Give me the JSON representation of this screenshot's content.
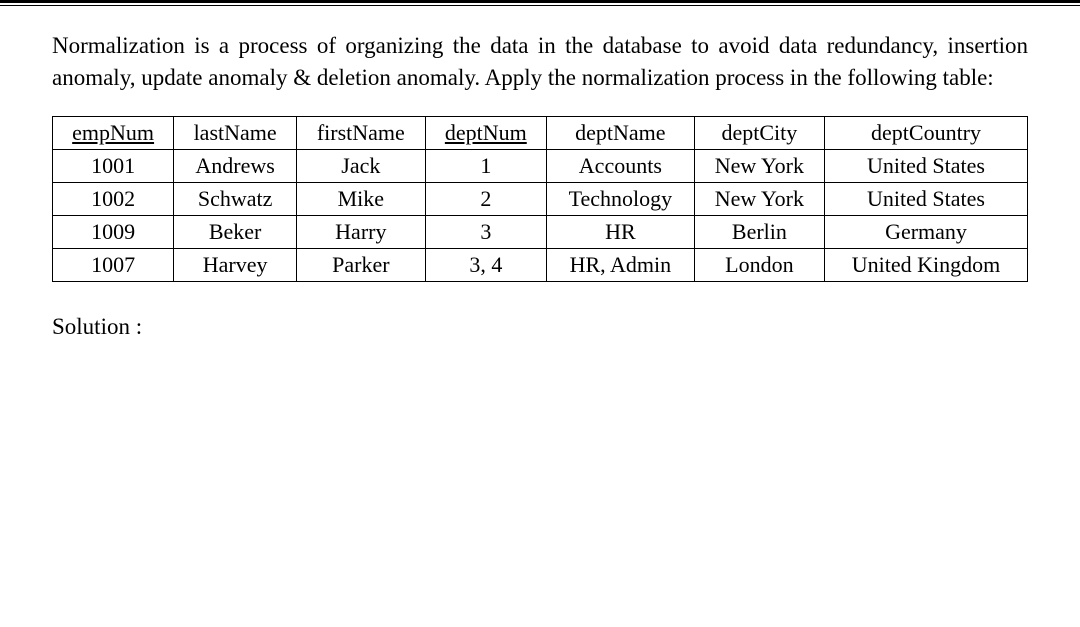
{
  "intro": "Normalization is a process of organizing the data in the database to avoid data redundancy, insertion anomaly, update anomaly & deletion anomaly. Apply the normalization process in the following table:",
  "table": {
    "headers": {
      "empNum": "empNum",
      "lastName": "lastName",
      "firstName": "firstName",
      "deptNum": "deptNum",
      "deptName": "deptName",
      "deptCity": "deptCity",
      "deptCountry": "deptCountry"
    },
    "rows": [
      {
        "empNum": "1001",
        "lastName": "Andrews",
        "firstName": "Jack",
        "deptNum": "1",
        "deptName": "Accounts",
        "deptCity": "New York",
        "deptCountry": "United States"
      },
      {
        "empNum": "1002",
        "lastName": "Schwatz",
        "firstName": "Mike",
        "deptNum": "2",
        "deptName": "Technology",
        "deptCity": "New York",
        "deptCountry": "United States"
      },
      {
        "empNum": "1009",
        "lastName": "Beker",
        "firstName": "Harry",
        "deptNum": "3",
        "deptName": "HR",
        "deptCity": "Berlin",
        "deptCountry": "Germany"
      },
      {
        "empNum": "1007",
        "lastName": "Harvey",
        "firstName": "Parker",
        "deptNum": "3, 4",
        "deptName": "HR, Admin",
        "deptCity": "London",
        "deptCountry": "United Kingdom"
      }
    ]
  },
  "solution_label": "Solution :"
}
